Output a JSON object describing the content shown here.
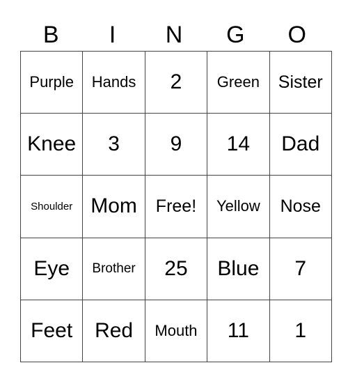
{
  "header": [
    "B",
    "I",
    "N",
    "G",
    "O"
  ],
  "rows": [
    [
      "Purple",
      "Hands",
      "2",
      "Green",
      "Sister"
    ],
    [
      "Knee",
      "3",
      "9",
      "14",
      "Dad"
    ],
    [
      "Shoulder",
      "Mom",
      "Free!",
      "Yellow",
      "Nose"
    ],
    [
      "Eye",
      "Brother",
      "25",
      "Blue",
      "7"
    ],
    [
      "Feet",
      "Red",
      "Mouth",
      "11",
      "1"
    ]
  ]
}
